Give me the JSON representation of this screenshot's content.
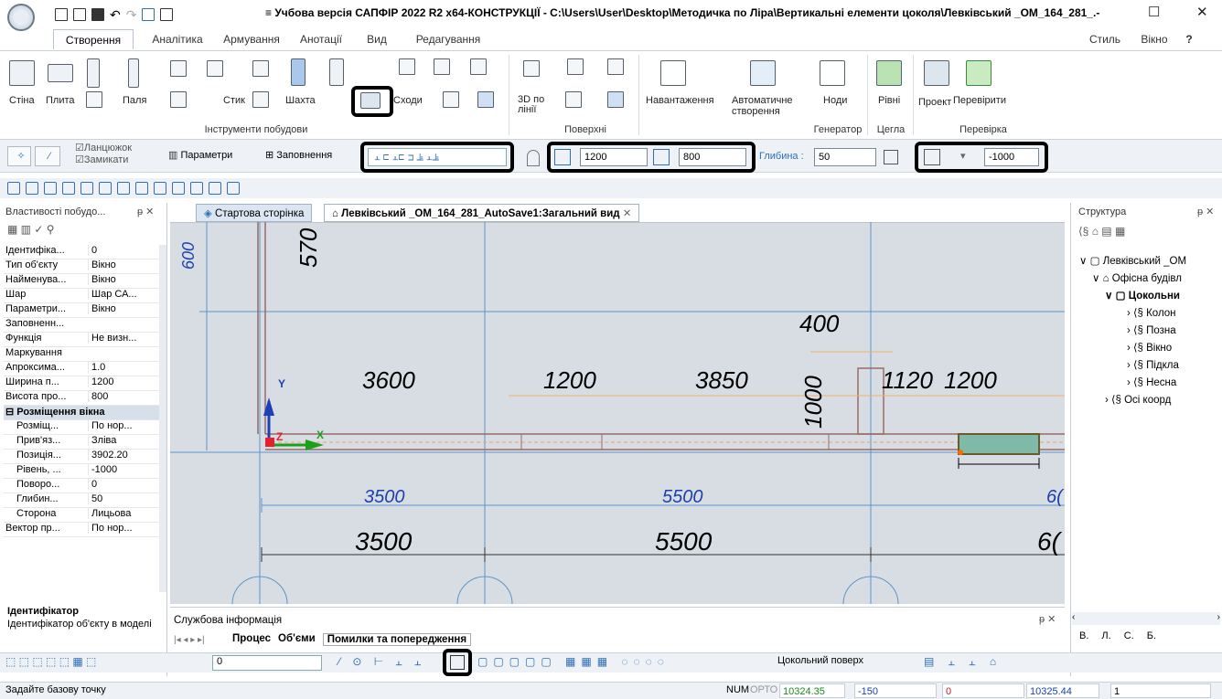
{
  "title": "≡ Учбова версія САПФІР 2022 R2 x64-КОНСТРУКЦІЇ - C:\\Users\\User\\Desktop\\Методичка по Ліра\\Вертикальні елементи цоколя\\Левківський _ОМ_164_281_.-",
  "window": {
    "minimize": "☐",
    "close": "✕"
  },
  "tabs": [
    "Створення",
    "Аналітика",
    "Армування",
    "Анотації",
    "Вид",
    "Редагування"
  ],
  "right_menu": {
    "style": "Стиль",
    "window": "Вікно"
  },
  "ribbon": {
    "wall": "Стіна",
    "slab": "Плита",
    "pile": "Паля",
    "joint": "Стик",
    "shaft": "Шахта",
    "stairs": "Сходи",
    "group_tools": "Інструменти побудови",
    "line3d": "3D по лінії",
    "group_surfaces": "Поверхні",
    "numbering": "Навантаження",
    "auto": "Автоматичне створення",
    "nodes": "Ноди",
    "group_generator": "Генератор",
    "levels": "Рівні",
    "group_brick": "Цегла",
    "project": "Проект",
    "check": "Перевірити",
    "group_check": "Перевірка"
  },
  "parambar": {
    "chain": "Ланцюжок",
    "close": "Замикати",
    "params": "Параметри",
    "fill": "Заповнення",
    "width": "1200",
    "height": "800",
    "depth_label": "Глибина :",
    "depth": "50",
    "level": "-1000"
  },
  "props": {
    "title": "Властивості побудо...",
    "rows": [
      {
        "k": "Ідентифіка...",
        "v": "0"
      },
      {
        "k": "Тип об'єкту",
        "v": "Вікно"
      },
      {
        "k": "Найменува...",
        "v": "Вікно"
      },
      {
        "k": "Шар",
        "v": "Шар СА..."
      },
      {
        "k": "Параметри...",
        "v": "Вікно"
      },
      {
        "k": "Заповненн...",
        "v": ""
      },
      {
        "k": "Функція",
        "v": "Не визн..."
      },
      {
        "k": "Маркування",
        "v": ""
      },
      {
        "k": "Апроксима...",
        "v": "1.0"
      },
      {
        "k": "Ширина п...",
        "v": "1200"
      },
      {
        "k": "Висота про...",
        "v": "800"
      }
    ],
    "section": "Розміщення вікна",
    "sub_rows": [
      {
        "k": "Розміщ...",
        "v": "По нор..."
      },
      {
        "k": "Прив'яз...",
        "v": "Зліва"
      },
      {
        "k": "Позиція...",
        "v": "3902.20"
      },
      {
        "k": "Рівень, ...",
        "v": "-1000"
      },
      {
        "k": "Поворо...",
        "v": "0"
      },
      {
        "k": "Глибин...",
        "v": "50"
      },
      {
        "k": "Сторона",
        "v": "Лицьова"
      }
    ],
    "last_row": {
      "k": "Вектор пр...",
      "v": "По нор..."
    },
    "desc_title": "Ідентифікатор",
    "desc_text": "Ідентифікатор об'єкту в моделі"
  },
  "doctabs": {
    "start": "Стартова сторінка",
    "view": "Левківський _ОМ_164_281_AutoSave1:Загальний вид"
  },
  "canvas": {
    "dims_top": [
      "600",
      "570",
      "400",
      "3600",
      "1200",
      "3850",
      "1000",
      "1120",
      "1200"
    ],
    "dims_blue": [
      "3500",
      "5500",
      "6("
    ],
    "dims_black": [
      "3500",
      "5500",
      "6("
    ],
    "axis_y": "Y",
    "axis_x": "X",
    "axis_z": "Z"
  },
  "struct": {
    "title": "Структура",
    "items": [
      "Левківський _ОМ",
      "Офісна будівл",
      "Цокольни",
      "Колон",
      "Позна",
      "Вікно",
      "Підкла",
      "Несна",
      "Осі коорд"
    ]
  },
  "struct_bottom": [
    "В.",
    "Л.",
    "С.",
    "Б."
  ],
  "service": {
    "title": "Службова інформація",
    "tabs": [
      "Процес",
      "Об'єми",
      "Помилки та попередження"
    ]
  },
  "bottombar": {
    "layer_value": "0",
    "floor": "Цокольний поверх"
  },
  "status": {
    "prompt": "Задайте базову точку",
    "num": "NUM",
    "orto": "ОРТО",
    "x": "10324.35",
    "y": "-150",
    "z": "0",
    "len": "10325.44",
    "n": "1"
  }
}
